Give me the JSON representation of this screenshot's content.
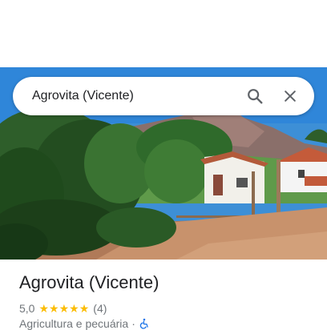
{
  "search": {
    "query": "Agrovita (Vicente)",
    "search_icon": "search-icon",
    "clear_icon": "close-icon"
  },
  "place": {
    "name": "Agrovita (Vicente)",
    "rating": "5,0",
    "stars": 5,
    "review_count": "(4)",
    "category": "Agricultura e pecuária",
    "separator": "·",
    "accessibility_icon": "wheelchair-icon"
  },
  "colors": {
    "star": "#fbbc04",
    "accessibility": "#1a73e8",
    "text_primary": "#202124",
    "text_secondary": "#70757a"
  }
}
